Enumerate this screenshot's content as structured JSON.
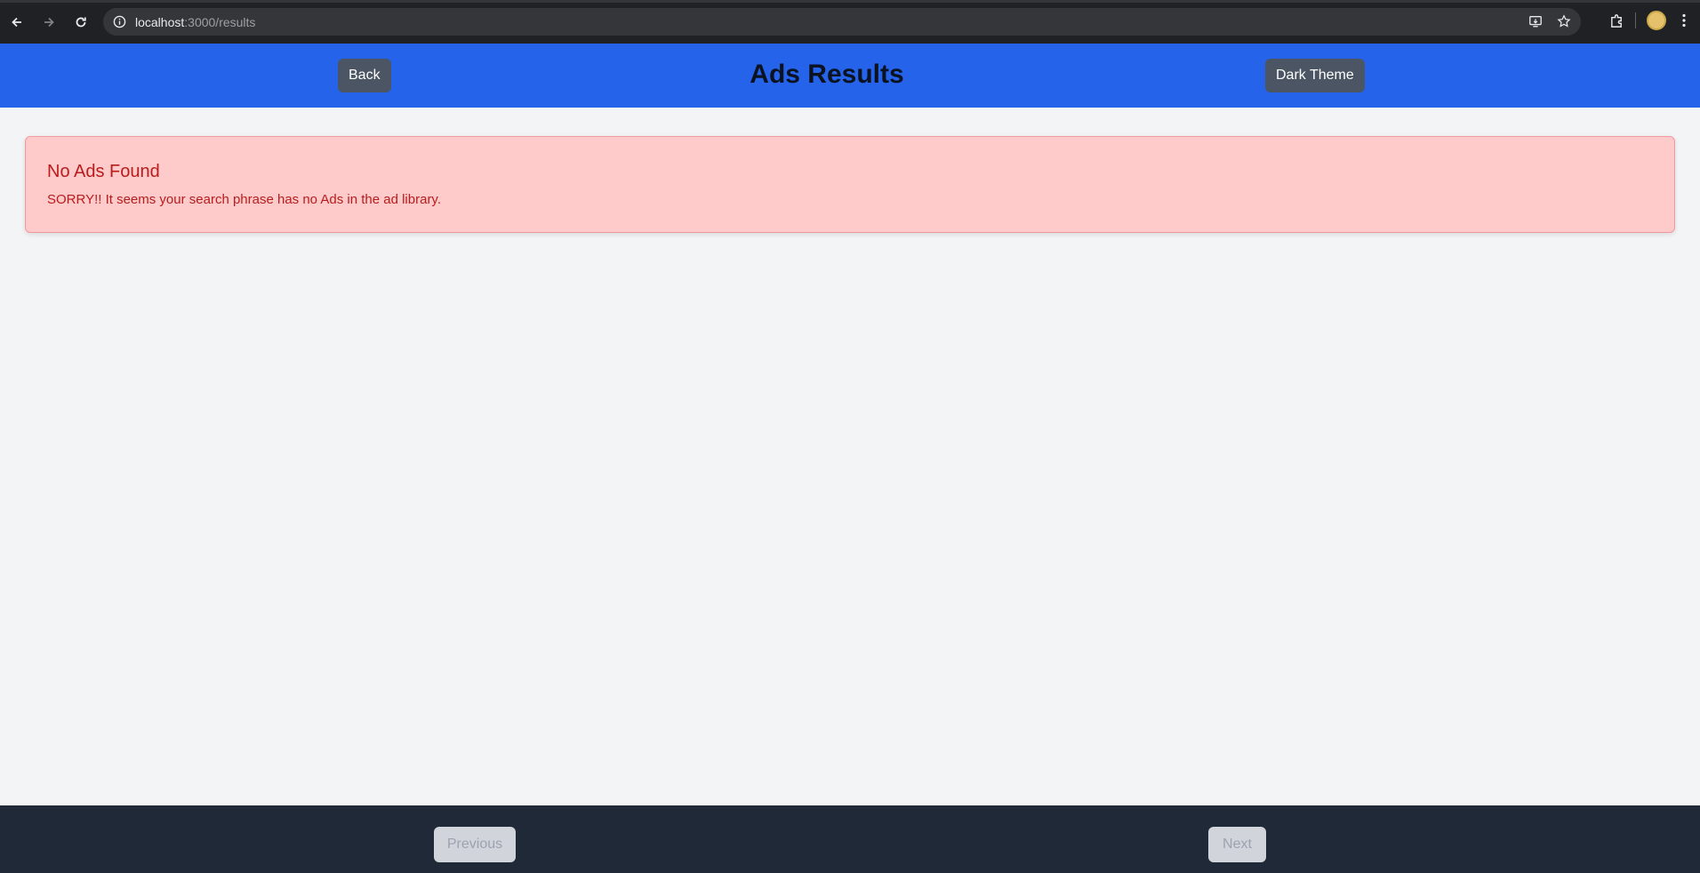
{
  "browser": {
    "url_host": "localhost",
    "url_rest": ":3000/results"
  },
  "header": {
    "back_label": "Back",
    "title": "Ads Results",
    "theme_label": "Dark Theme",
    "background_color": "#2563eb"
  },
  "alert": {
    "title": "No Ads Found",
    "message": "SORRY!! It seems your search phrase has no Ads in the ad library.",
    "background_color": "#fecaca",
    "text_color": "#b91c1c"
  },
  "pagination": {
    "previous_label": "Previous",
    "next_label": "Next",
    "previous_disabled": true,
    "next_disabled": true
  },
  "icons": {
    "back": "arrow-left-icon",
    "forward": "arrow-right-icon",
    "reload": "reload-icon",
    "site_info": "info-icon",
    "install": "install-app-icon",
    "bookmark": "star-icon",
    "extensions": "puzzle-icon",
    "menu": "kebab-menu-icon"
  }
}
